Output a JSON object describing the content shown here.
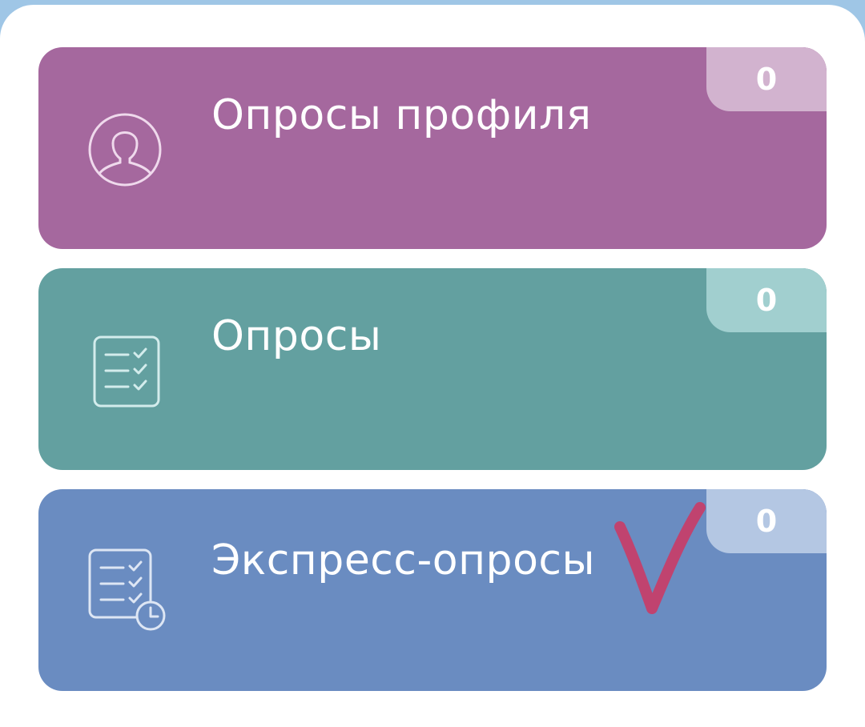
{
  "colors": {
    "page_background": "#9fc6e6",
    "panel_background": "#ffffff",
    "check_mark": "#c0436f"
  },
  "cards": [
    {
      "title": "Опросы профиля",
      "count": "0",
      "icon": "profile-icon",
      "color": "#a5689e",
      "badge_color": "#d2b3cf"
    },
    {
      "title": "Опросы",
      "count": "0",
      "icon": "checklist-icon",
      "color": "#63a0a0",
      "badge_color": "#a1cfcf"
    },
    {
      "title": "Экспресс-опросы",
      "count": "0",
      "icon": "checklist-clock-icon",
      "color": "#6a8cc1",
      "badge_color": "#b4c7e3"
    }
  ],
  "annotation": {
    "icon": "handwritten-check-mark"
  }
}
